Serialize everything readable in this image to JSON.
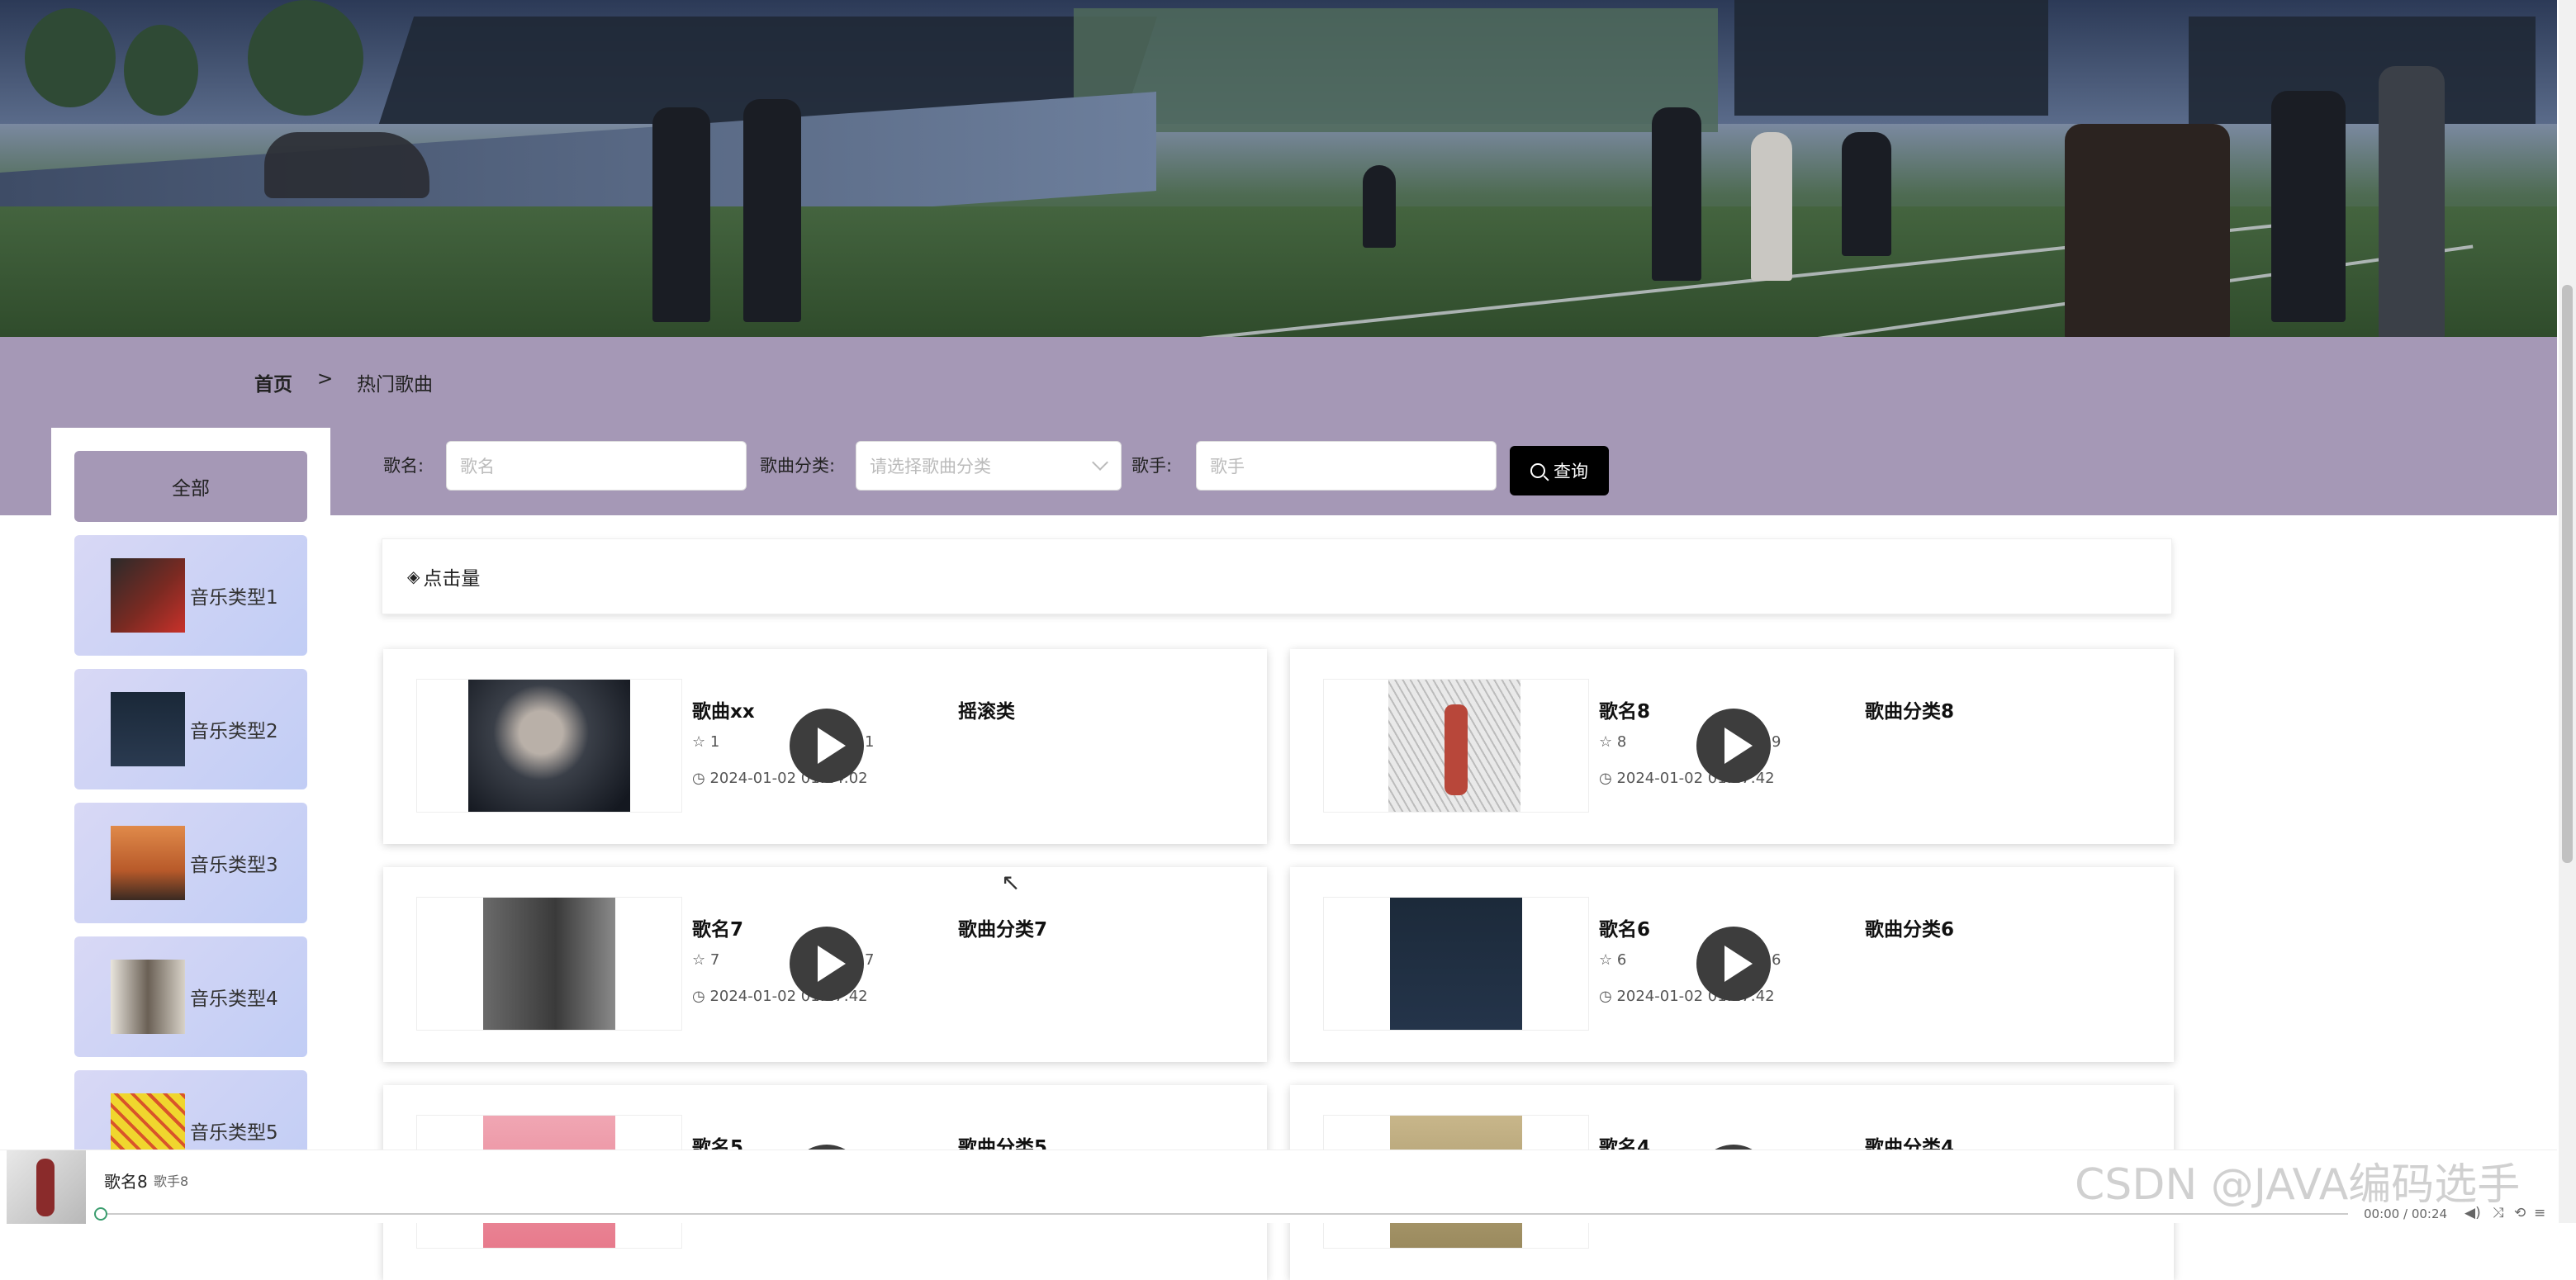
{
  "breadcrumb": {
    "home": "首页",
    "separator": ">",
    "current": "热门歌曲"
  },
  "sidebar": {
    "all_label": "全部",
    "items": [
      {
        "label": "音乐类型1",
        "thumb_color": "#5a2a22"
      },
      {
        "label": "音乐类型2",
        "thumb_color": "#1e2d3f"
      },
      {
        "label": "音乐类型3",
        "thumb_color": "#c86a3a"
      },
      {
        "label": "音乐类型4",
        "thumb_color": "#a9a39a"
      },
      {
        "label": "音乐类型5",
        "thumb_color": "#e9d23a"
      }
    ]
  },
  "search": {
    "name_label": "歌名:",
    "name_placeholder": "歌名",
    "category_label": "歌曲分类:",
    "category_placeholder": "请选择歌曲分类",
    "singer_label": "歌手:",
    "singer_placeholder": "歌手",
    "button_label": "查询"
  },
  "sort": {
    "label": "点击量"
  },
  "songs": [
    {
      "title": "歌曲xx",
      "category": "摇滚类",
      "stars": "1",
      "views": "1",
      "time": "2024-01-02 01:24:02"
    },
    {
      "title": "歌名8",
      "category": "歌曲分类8",
      "stars": "8",
      "views": "9",
      "time": "2024-01-02 01:17:42"
    },
    {
      "title": "歌名7",
      "category": "歌曲分类7",
      "stars": "7",
      "views": "7",
      "time": "2024-01-02 01:17:42"
    },
    {
      "title": "歌名6",
      "category": "歌曲分类6",
      "stars": "6",
      "views": "6",
      "time": "2024-01-02 01:17:42"
    },
    {
      "title": "歌名5",
      "category": "歌曲分类5",
      "stars": "",
      "views": "",
      "time": ""
    },
    {
      "title": "歌名4",
      "category": "歌曲分类4",
      "stars": "",
      "views": "",
      "time": ""
    }
  ],
  "player": {
    "song": "歌名8",
    "singer": "歌手8",
    "time": "00:00 / 00:24"
  },
  "watermark": "CSDN @JAVA编码选手",
  "colors": {
    "band": "#a598b6",
    "sidebar_item": "#c9d3f5",
    "button": "#000000"
  }
}
